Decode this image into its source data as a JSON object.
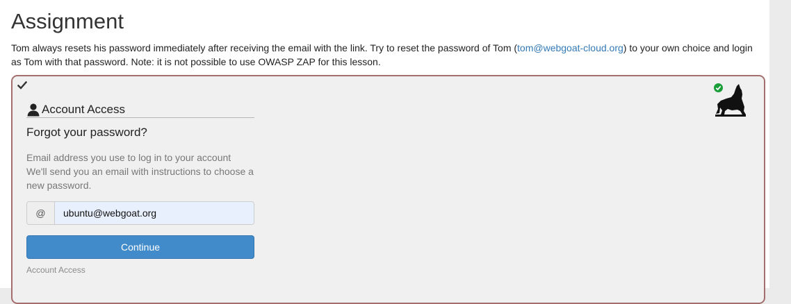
{
  "page": {
    "title": "Assignment",
    "description_before": "Tom always resets his password immediately after receiving the email with the link. Try to reset the password of Tom (",
    "description_link": "tom@webgoat-cloud.org",
    "description_after": ") to your own choice and login as Tom with that password. Note: it is not possible to use OWASP ZAP for this lesson."
  },
  "form": {
    "header": "Account Access",
    "heading": "Forgot your password?",
    "help_line1": "Email address you use to log in to your account",
    "help_line2": "We'll send you an email with instructions to choose a new password.",
    "addon": "@",
    "email_value": "ubuntu@webgoat.org",
    "continue_label": "Continue",
    "footer_link": "Account Access"
  },
  "colors": {
    "panel_border": "#a46e6e",
    "button": "#428bca",
    "link": "#337ab7",
    "success": "#1a9e3a"
  },
  "icons": {
    "solved": "check-icon",
    "user": "user-icon",
    "status": "green-check-icon",
    "logo": "wolf-howling-icon"
  }
}
